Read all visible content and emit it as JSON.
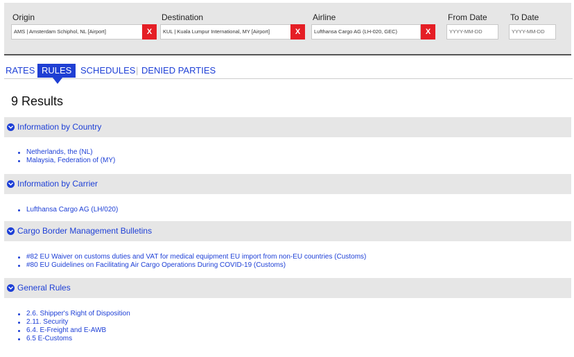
{
  "search": {
    "origin_label": "Origin",
    "origin_value": "AMS | Amsterdam Schiphol, NL [Airport]",
    "destination_label": "Destination",
    "destination_value": "KUL | Kuala Lumpur International, MY [Airport]",
    "airline_label": "Airline",
    "airline_value": "Lufthansa Cargo AG (LH-020, GEC)",
    "clear_label": "X",
    "from_date_label": "From Date",
    "from_date_placeholder": "YYYY-MM-DD",
    "to_date_label": "To Date",
    "to_date_placeholder": "YYYY-MM-DD"
  },
  "tabs": {
    "rates": "RATES",
    "rules": "RULES",
    "schedules": "SCHEDULES",
    "separator": "|",
    "denied_parties": "DENIED PARTIES",
    "active": "RULES"
  },
  "results": {
    "count_text": "9 Results"
  },
  "sections": [
    {
      "title": "Information by Country",
      "items": [
        "Netherlands, the (NL)",
        "Malaysia, Federation of (MY)"
      ]
    },
    {
      "title": "Information by Carrier",
      "items": [
        "Lufthansa Cargo AG (LH/020)"
      ]
    },
    {
      "title": "Cargo Border Management Bulletins",
      "items": [
        "#82 EU Waiver on customs duties and VAT for medical equipment EU import from non-EU countries (Customs)",
        "#80 EU Guidelines on Facilitating Air Cargo Operations During COVID-19 (Customs)"
      ]
    },
    {
      "title": "General Rules",
      "items": [
        "2.6. Shipper's Right of Disposition",
        "2.11. Security",
        "6.4. E-Freight and E-AWB",
        "6.5 E-Customs"
      ]
    }
  ],
  "colors": {
    "accent": "#1d3fd6",
    "clear_button": "#e51e25",
    "panel": "#e6e6e6"
  }
}
